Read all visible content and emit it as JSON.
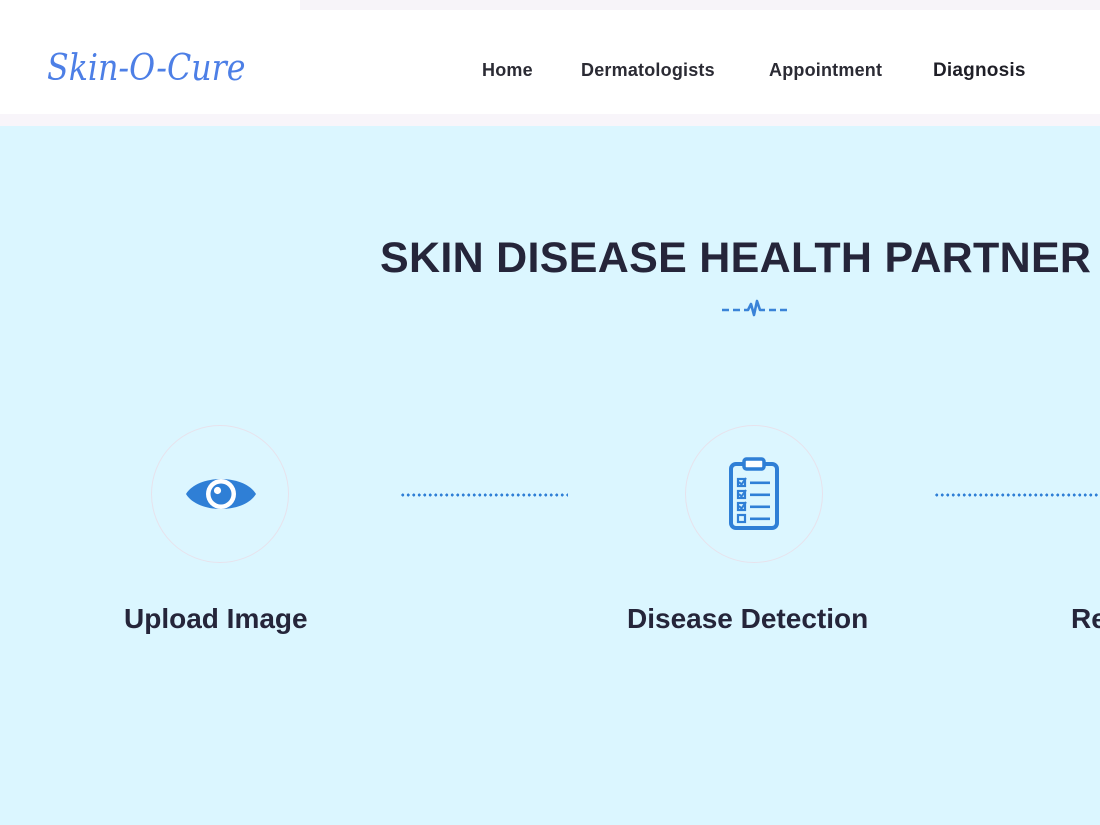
{
  "header": {
    "logo": "Skin-O-Cure",
    "nav": [
      {
        "label": "Home"
      },
      {
        "label": "Dermatologists"
      },
      {
        "label": "Appointment"
      },
      {
        "label": "Diagnosis"
      }
    ]
  },
  "hero": {
    "title": "SKIN DISEASE HEALTH PARTNER",
    "divider_icon": "heartbeat-icon"
  },
  "steps": [
    {
      "label": "Upload Image",
      "icon": "eye-icon"
    },
    {
      "label": "Disease Detection",
      "icon": "clipboard-checklist-icon"
    },
    {
      "label": "Re"
    }
  ],
  "colors": {
    "brand_blue": "#4d7fe6",
    "icon_blue": "#2f7fd6",
    "background": "#dbf6ff",
    "text_dark": "#25253a"
  }
}
